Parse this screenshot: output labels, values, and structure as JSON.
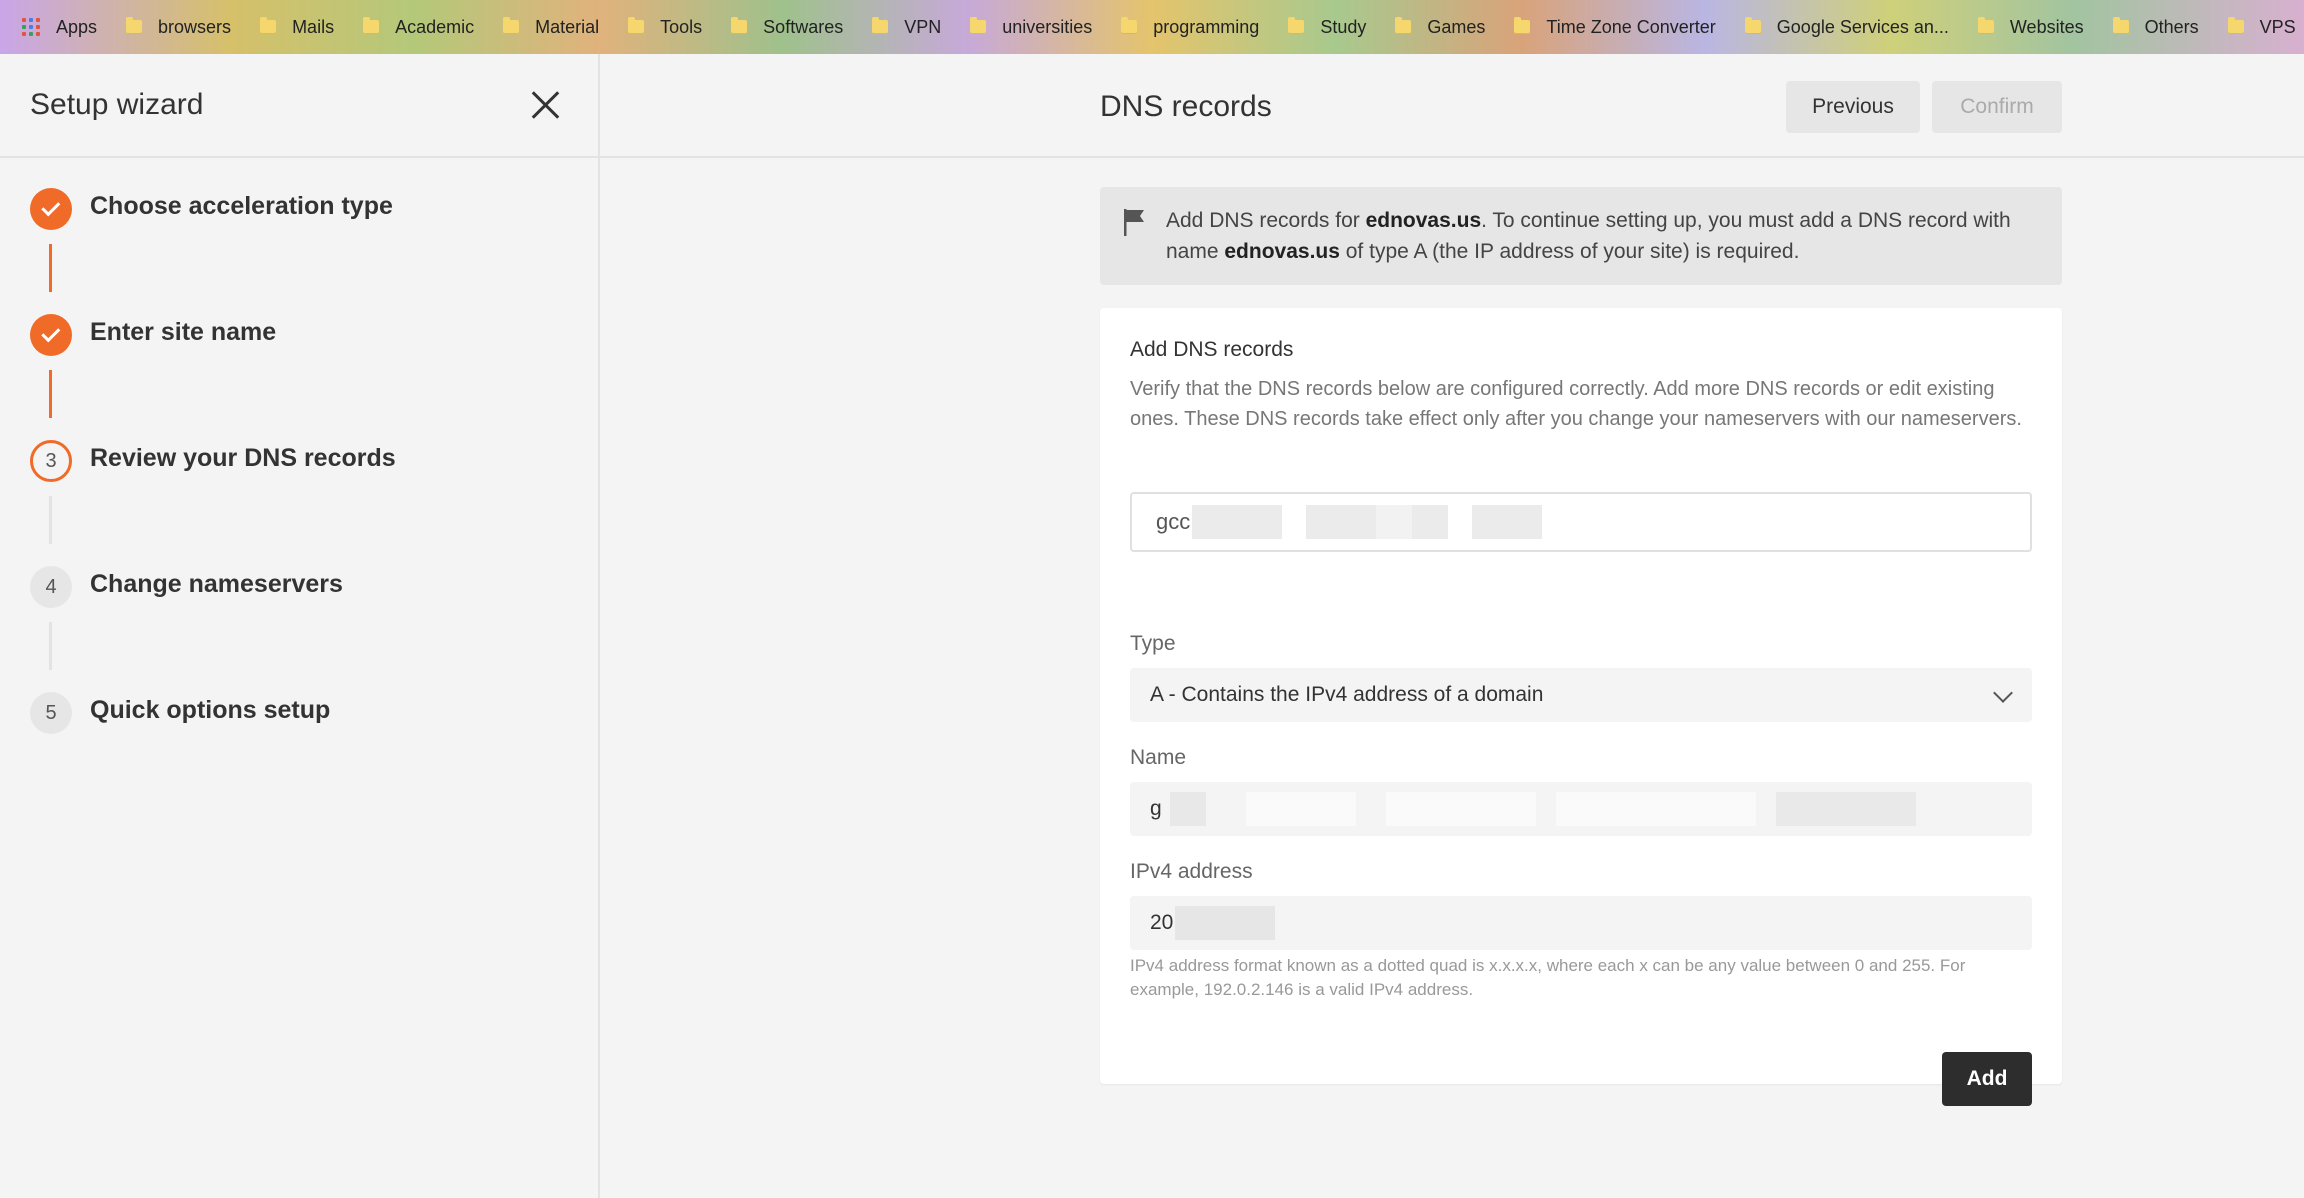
{
  "bookmarks": {
    "apps_label": "Apps",
    "folders": [
      "browsers",
      "Mails",
      "Academic",
      "Material",
      "Tools",
      "Softwares",
      "VPN",
      "universities",
      "programming",
      "Study",
      "Games",
      "Time Zone Converter",
      "Google Services an...",
      "Websites",
      "Others",
      "VPS"
    ]
  },
  "sidebar": {
    "title": "Setup wizard",
    "steps": [
      {
        "number": "",
        "label": "Choose acceleration type",
        "state": "done"
      },
      {
        "number": "",
        "label": "Enter site name",
        "state": "done"
      },
      {
        "number": "3",
        "label": "Review your DNS records",
        "state": "active"
      },
      {
        "number": "4",
        "label": "Change nameservers",
        "state": "todo"
      },
      {
        "number": "5",
        "label": "Quick options setup",
        "state": "todo"
      }
    ]
  },
  "main": {
    "title": "DNS records",
    "previous_label": "Previous",
    "confirm_label": "Confirm",
    "notice": {
      "prefix": "Add DNS records for ",
      "domain": "ednovas.us",
      "middle": ". To continue setting up, you must add a DNS record with name ",
      "domain2": "ednovas.us",
      "suffix": " of type A (the IP address of your site) is required."
    },
    "card": {
      "title": "Add DNS records",
      "description": "Verify that the DNS records below are configured correctly. Add more DNS records or edit existing ones. These DNS records take effect only after you change your nameservers with our nameservers.",
      "search_value": "gcc",
      "type_label": "Type",
      "type_value": "A - Contains the IPv4 address of a domain",
      "name_label": "Name",
      "name_value": "g",
      "ipv4_label": "IPv4 address",
      "ipv4_value": "20",
      "hint": "IPv4 address format known as a dotted quad is x.x.x.x, where each x can be any value between 0 and 255. For example, 192.0.2.146 is a valid IPv4 address.",
      "add_label": "Add"
    }
  },
  "colors": {
    "accent": "#f06a28",
    "primary_button": "#2d2d2d",
    "panel_bg": "#f4f4f4"
  }
}
